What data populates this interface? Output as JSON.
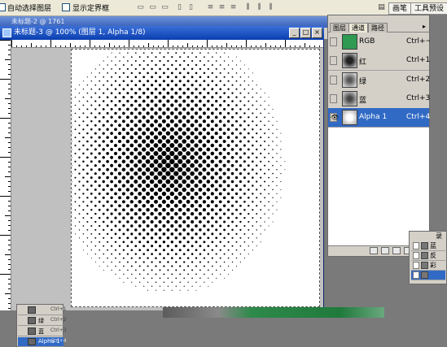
{
  "options_bar": {
    "auto_select_label": "自动选择图层",
    "show_bounding_box_label": "显示定界框",
    "tabs": [
      "画笔",
      "工具预设"
    ]
  },
  "back_window": {
    "title": "未标题-2 @ 1761"
  },
  "document": {
    "title": "未标题-3 @ 100% (图层 1, Alpha 1/8)",
    "icons": [
      "minimize-icon",
      "maximize-icon",
      "close-icon"
    ]
  },
  "channels_panel": {
    "tabs": [
      "图层",
      "通道",
      "路径"
    ],
    "active_tab": "通道",
    "channels": [
      {
        "name": "RGB",
        "shortcut": "Ctrl+~",
        "selected": false,
        "visible": false,
        "thumb": "#2e9a52"
      },
      {
        "name": "红",
        "shortcut": "Ctrl+1",
        "selected": false,
        "visible": false,
        "thumb": "#9a9a9a"
      },
      {
        "name": "绿",
        "shortcut": "Ctrl+2",
        "selected": false,
        "visible": false,
        "thumb": "#b8b8b8"
      },
      {
        "name": "蓝",
        "shortcut": "Ctrl+3",
        "selected": false,
        "visible": false,
        "thumb": "#a8a8a8"
      },
      {
        "name": "Alpha 1",
        "shortcut": "Ctrl+4",
        "selected": true,
        "visible": true,
        "thumb": "#dcdcdc"
      }
    ],
    "eye_glyph": "👁"
  },
  "right_panel": {
    "title": "录",
    "rows": [
      "蓝",
      "反",
      "彩"
    ]
  },
  "bottom_panel": {
    "rows": [
      {
        "name": "",
        "key": "Ctrl+1"
      },
      {
        "name": "绿",
        "key": "Ctrl+2"
      },
      {
        "name": "蓝",
        "key": "Ctrl+3"
      },
      {
        "name": "Alpha 1",
        "key": "Ctrl+4"
      }
    ]
  },
  "colors": {
    "title_active": "#0a3fb0",
    "selection": "#316ac5",
    "rgb_thumb": "#2e9a52"
  }
}
